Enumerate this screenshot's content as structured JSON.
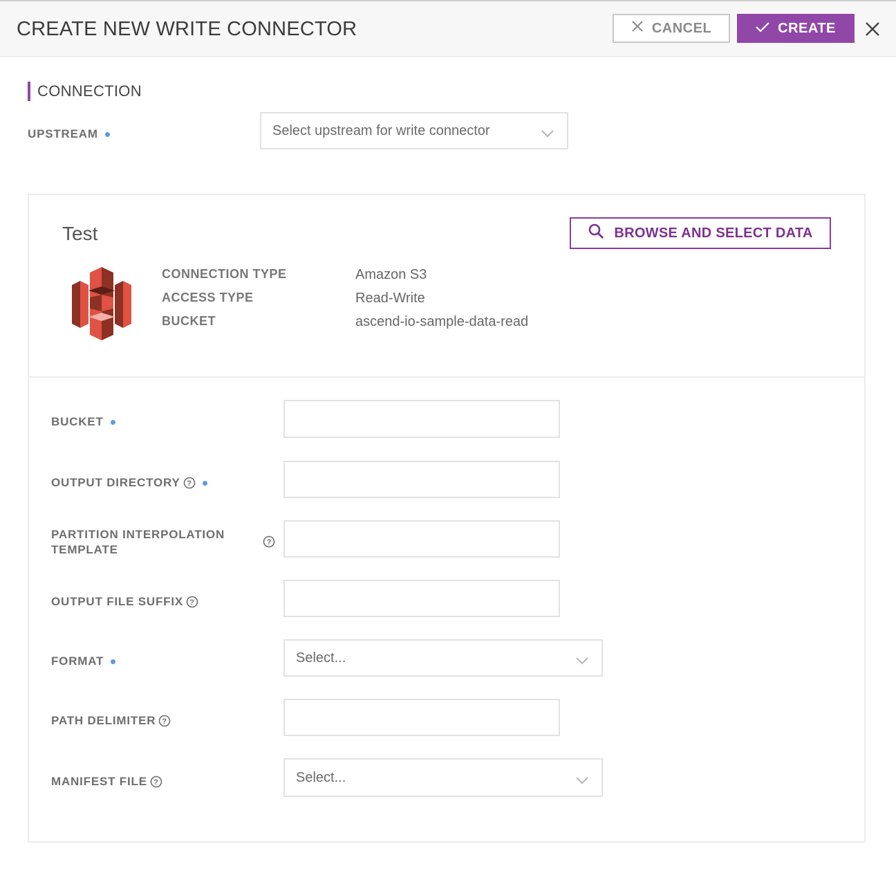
{
  "header": {
    "title": "CREATE NEW WRITE CONNECTOR",
    "cancel_label": "CANCEL",
    "create_label": "CREATE",
    "accent_color": "#9047a8"
  },
  "connection_section": {
    "title": "CONNECTION",
    "upstream_label": "UPSTREAM",
    "upstream_placeholder": "Select upstream for write connector"
  },
  "connection_card": {
    "name": "Test",
    "browse_label": "BROWSE AND SELECT DATA",
    "icon": "amazon-s3-logo",
    "details": [
      {
        "key": "CONNECTION TYPE",
        "value": "Amazon S3"
      },
      {
        "key": "ACCESS TYPE",
        "value": "Read-Write"
      },
      {
        "key": "BUCKET",
        "value": "ascend-io-sample-data-read"
      }
    ]
  },
  "form": {
    "bucket_label": "BUCKET",
    "output_directory_label": "OUTPUT DIRECTORY",
    "partition_template_label_line1": "PARTITION INTERPOLATION",
    "partition_template_label_line2": "TEMPLATE",
    "output_file_suffix_label": "OUTPUT FILE SUFFIX",
    "format_label": "FORMAT",
    "format_placeholder": "Select...",
    "path_delimiter_label": "PATH DELIMITER",
    "manifest_file_label": "MANIFEST FILE",
    "manifest_file_placeholder": "Select..."
  }
}
